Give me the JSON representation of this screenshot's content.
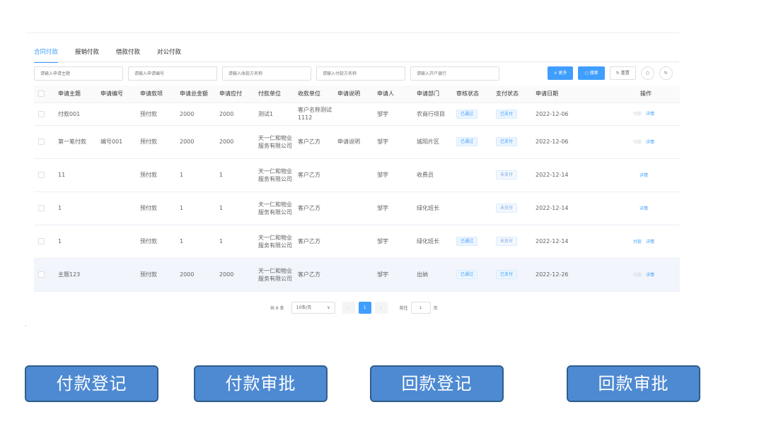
{
  "tabs": [
    {
      "label": "合同付款",
      "active": true
    },
    {
      "label": "报销付款",
      "active": false
    },
    {
      "label": "借款付款",
      "active": false
    },
    {
      "label": "对公付款",
      "active": false
    }
  ],
  "filters": [
    {
      "placeholder": "请输入申请主题"
    },
    {
      "placeholder": "请输入申请编号"
    },
    {
      "placeholder": "请输入收款方名称"
    },
    {
      "placeholder": "请输入付款方名称"
    },
    {
      "placeholder": "请输入开户银行"
    }
  ],
  "toolbar": {
    "more_label": "更多",
    "search_label": "搜索",
    "reset_label": "重置"
  },
  "table": {
    "headers": [
      "申请主题",
      "申请编号",
      "申请款项",
      "申请总金额",
      "申请应付",
      "付款单位",
      "收款单位",
      "申请说明",
      "申请人",
      "申请部门",
      "审核状态",
      "支付状态",
      "申请日期",
      "操作"
    ],
    "rows": [
      {
        "subject": "付款001",
        "number": "",
        "item": "预付款",
        "total": "2000",
        "payable": "2000",
        "payer": "测试1",
        "payee": "客户名称测试1112",
        "desc": "",
        "applicant": "邹宇",
        "dept": "农商行项目",
        "audit": "已通过",
        "pay": "已支付",
        "date": "2022-12-06",
        "op_pay": "付款",
        "op_detail": "详情"
      },
      {
        "subject": "第一笔付款",
        "number": "编号001",
        "item": "预付款",
        "total": "2000",
        "payable": "2000",
        "payer": "天一仁和物业服务有限公司",
        "payee": "客户乙方",
        "desc": "申请说明",
        "applicant": "邹宇",
        "dept": "城阳片区",
        "audit": "已通过",
        "pay": "已支付",
        "date": "2022-12-06",
        "op_pay": "付款",
        "op_detail": "详情"
      },
      {
        "subject": "11",
        "number": "",
        "item": "预付款",
        "total": "1",
        "payable": "1",
        "payer": "天一仁和物业服务有限公司",
        "payee": "客户乙方",
        "desc": "",
        "applicant": "邹宇",
        "dept": "收费员",
        "audit": "",
        "pay": "未支付",
        "date": "2022-12-14",
        "op_pay": "",
        "op_detail": "详情"
      },
      {
        "subject": "1",
        "number": "",
        "item": "预付款",
        "total": "1",
        "payable": "1",
        "payer": "天一仁和物业服务有限公司",
        "payee": "客户乙方",
        "desc": "",
        "applicant": "邹宇",
        "dept": "绿化班长",
        "audit": "",
        "pay": "未支付",
        "date": "2022-12-14",
        "op_pay": "",
        "op_detail": "详情"
      },
      {
        "subject": "1",
        "number": "",
        "item": "预付款",
        "total": "1",
        "payable": "1",
        "payer": "天一仁和物业服务有限公司",
        "payee": "客户乙方",
        "desc": "",
        "applicant": "邹宇",
        "dept": "绿化班长",
        "audit": "已通过",
        "pay": "未支付",
        "date": "2022-12-14",
        "op_pay": "付款",
        "op_detail": "详情"
      },
      {
        "subject": "主题123",
        "number": "",
        "item": "预付款",
        "total": "2000",
        "payable": "2000",
        "payer": "天一仁和物业服务有限公司",
        "payee": "客户乙方",
        "desc": "",
        "applicant": "邹宇",
        "dept": "出纳",
        "audit": "已通过",
        "pay": "已支付",
        "date": "2022-12-26",
        "op_pay": "付款",
        "op_detail": "详情"
      }
    ]
  },
  "pagination": {
    "total": "共 6 条",
    "page_size": "10条/页",
    "current_page": "1",
    "goto_prefix": "前往",
    "goto_value": "1",
    "goto_suffix": "页"
  },
  "big_buttons": [
    "付款登记",
    "付款审批",
    "回款登记",
    "回款审批"
  ],
  "colors": {
    "accent": "#409eff",
    "big_button": "#4e8ad2"
  }
}
